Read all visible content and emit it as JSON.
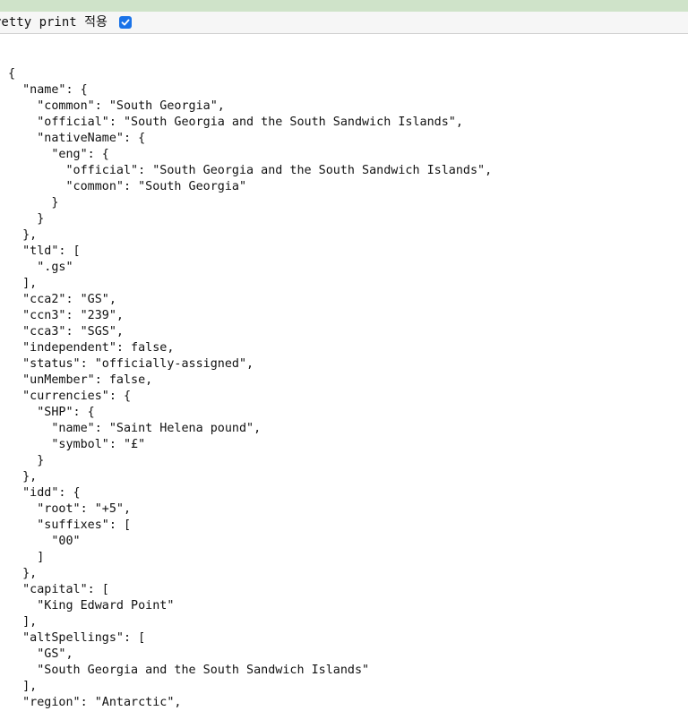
{
  "toolbar": {
    "pretty_print_label": "retty print 적용",
    "pretty_print_checked": true,
    "accent_color": "#1a73e8"
  },
  "json_text": "{\n  \"name\": {\n    \"common\": \"South Georgia\",\n    \"official\": \"South Georgia and the South Sandwich Islands\",\n    \"nativeName\": {\n      \"eng\": {\n        \"official\": \"South Georgia and the South Sandwich Islands\",\n        \"common\": \"South Georgia\"\n      }\n    }\n  },\n  \"tld\": [\n    \".gs\"\n  ],\n  \"cca2\": \"GS\",\n  \"ccn3\": \"239\",\n  \"cca3\": \"SGS\",\n  \"independent\": false,\n  \"status\": \"officially-assigned\",\n  \"unMember\": false,\n  \"currencies\": {\n    \"SHP\": {\n      \"name\": \"Saint Helena pound\",\n      \"symbol\": \"£\"\n    }\n  },\n  \"idd\": {\n    \"root\": \"+5\",\n    \"suffixes\": [\n      \"00\"\n    ]\n  },\n  \"capital\": [\n    \"King Edward Point\"\n  ],\n  \"altSpellings\": [\n    \"GS\",\n    \"South Georgia and the South Sandwich Islands\"\n  ],\n  \"region\": \"Antarctic\","
}
